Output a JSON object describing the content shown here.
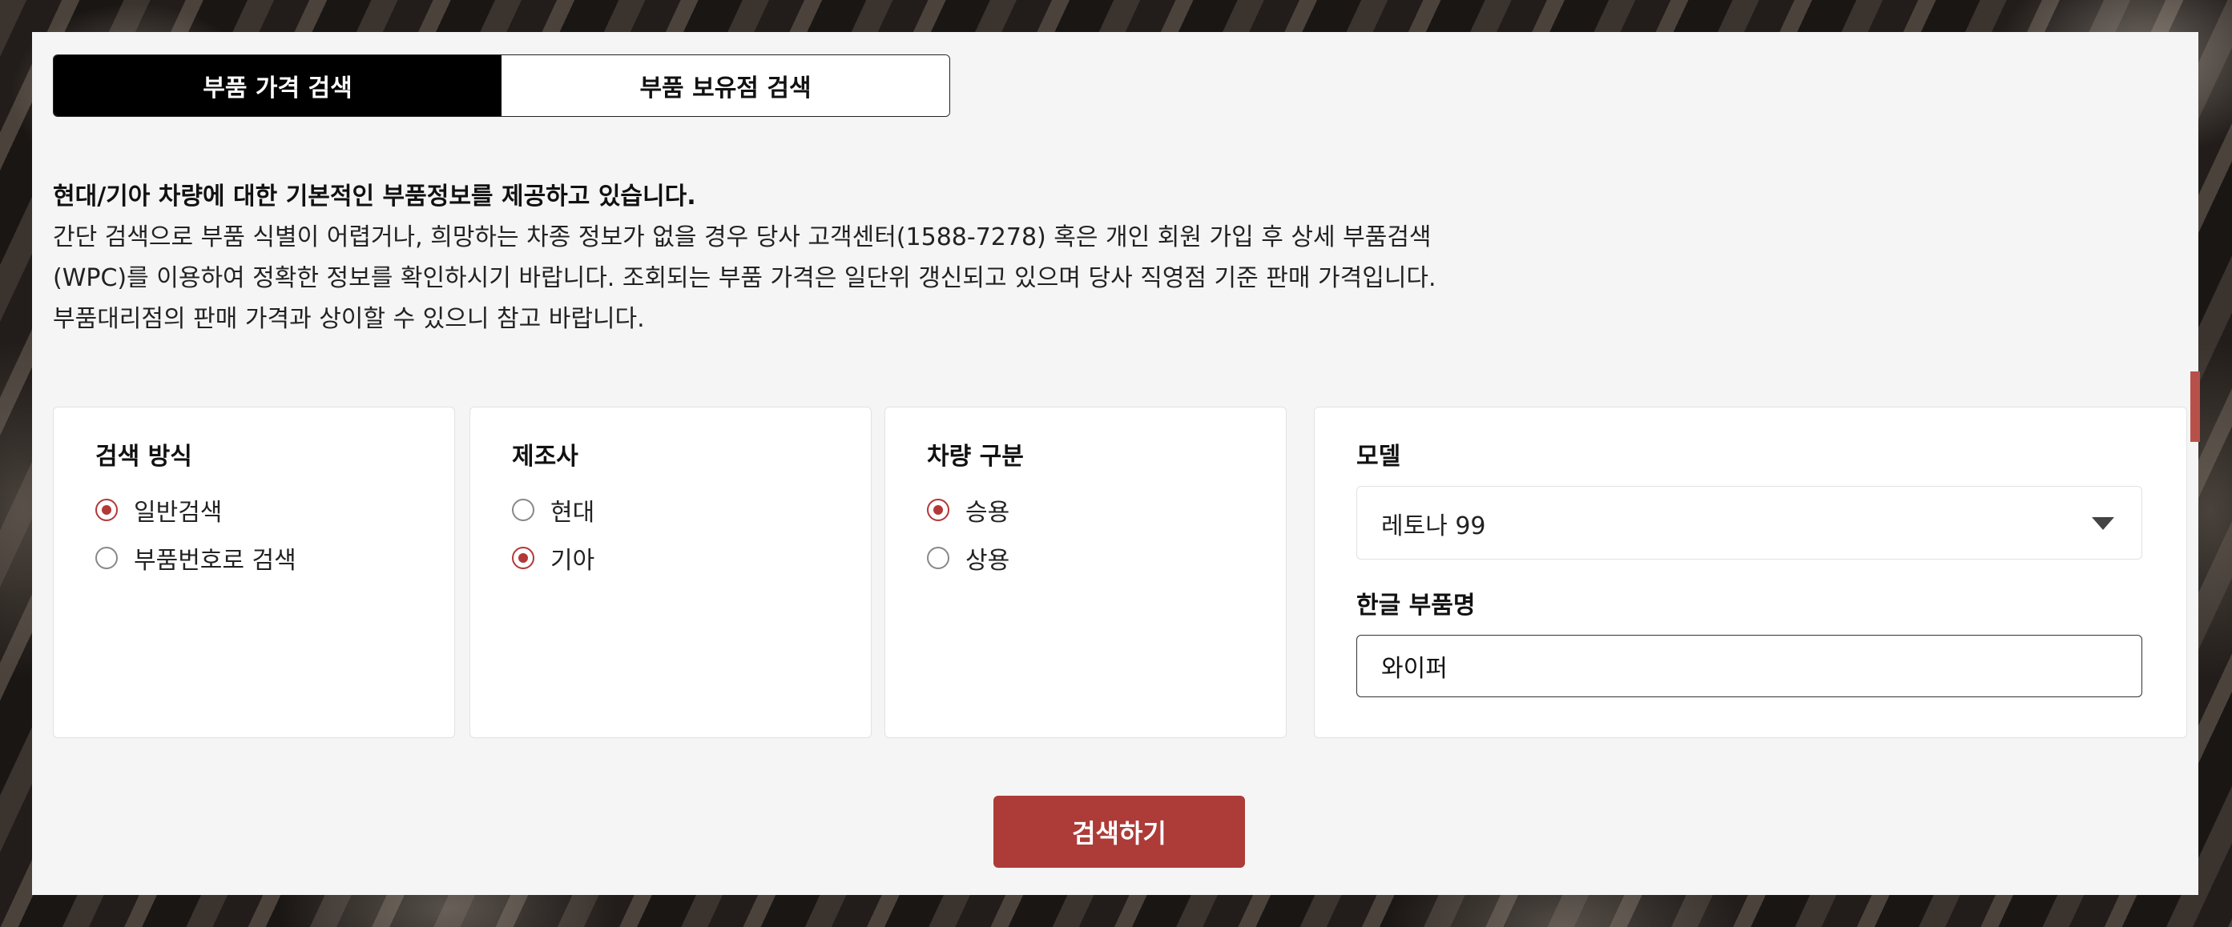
{
  "tabs": {
    "price_search": "부품 가격 검색",
    "store_search": "부품 보유점 검색"
  },
  "intro": {
    "headline": "현대/기아 차량에 대한 기본적인 부품정보를 제공하고 있습니다.",
    "line1": "간단 검색으로 부품 식별이 어렵거나, 희망하는 차종 정보가 없을 경우 당사 고객센터(1588-7278) 혹은 개인 회원 가입 후 상세 부품검색",
    "line2": "(WPC)를 이용하여 정확한 정보를 확인하시기 바랍니다. 조회되는 부품 가격은 일단위 갱신되고 있으며 당사 직영점 기준 판매 가격입니다.",
    "line3": "부품대리점의 판매 가격과 상이할 수 있으니 참고 바랍니다."
  },
  "search_method": {
    "title": "검색 방식",
    "options": [
      {
        "label": "일반검색",
        "checked": true
      },
      {
        "label": "부품번호로 검색",
        "checked": false
      }
    ]
  },
  "manufacturer": {
    "title": "제조사",
    "options": [
      {
        "label": "현대",
        "checked": false
      },
      {
        "label": "기아",
        "checked": true
      }
    ]
  },
  "vehicle_type": {
    "title": "차량 구분",
    "options": [
      {
        "label": "승용",
        "checked": true
      },
      {
        "label": "상용",
        "checked": false
      }
    ]
  },
  "model": {
    "title": "모델",
    "selected": "레토나 99"
  },
  "part_name": {
    "title": "한글 부품명",
    "value": "와이퍼"
  },
  "search_button": "검색하기",
  "colors": {
    "accent": "#ad3b38",
    "tab_active": "#000000",
    "panel_bg": "#f5f5f5"
  }
}
